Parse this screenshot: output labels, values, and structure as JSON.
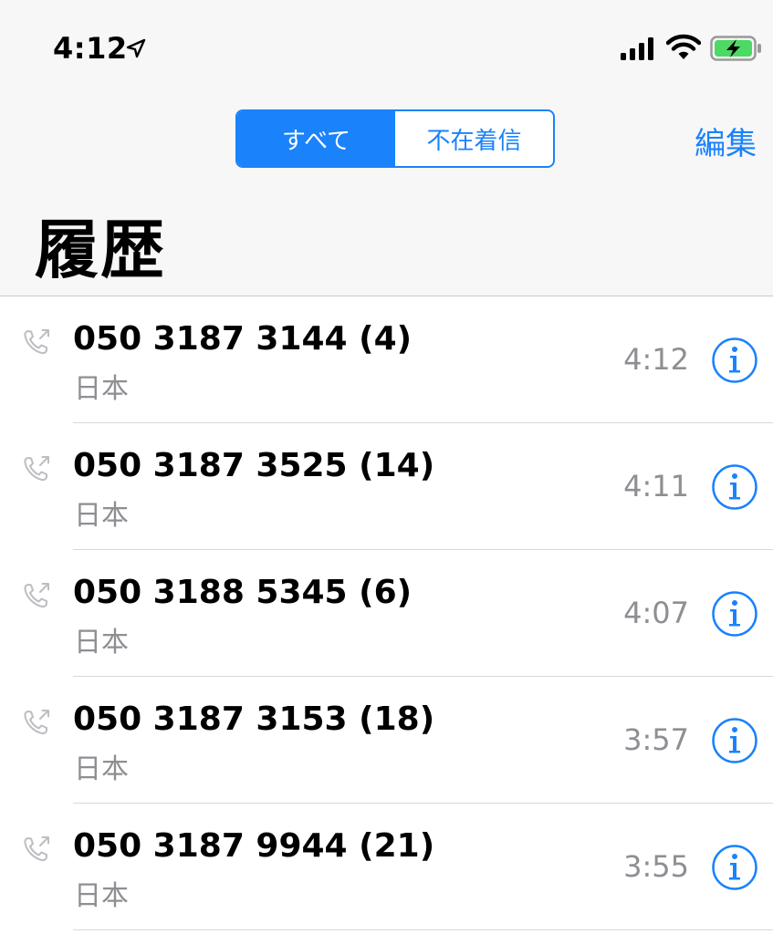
{
  "status_bar": {
    "time": "4:12"
  },
  "header": {
    "segments": [
      {
        "label": "すべて",
        "selected": true
      },
      {
        "label": "不在着信",
        "selected": false
      }
    ],
    "edit_label": "編集",
    "title": "履歴"
  },
  "colors": {
    "accent": "#1a82fb",
    "secondary_text": "#8e8e93",
    "header_bg": "#f7f7f7"
  },
  "calls": [
    {
      "number": "050 3187 3144 (4)",
      "country": "日本",
      "time": "4:12"
    },
    {
      "number": "050 3187 3525 (14)",
      "country": "日本",
      "time": "4:11"
    },
    {
      "number": "050 3188 5345 (6)",
      "country": "日本",
      "time": "4:07"
    },
    {
      "number": "050 3187 3153 (18)",
      "country": "日本",
      "time": "3:57"
    },
    {
      "number": "050 3187 9944 (21)",
      "country": "日本",
      "time": "3:55"
    }
  ]
}
